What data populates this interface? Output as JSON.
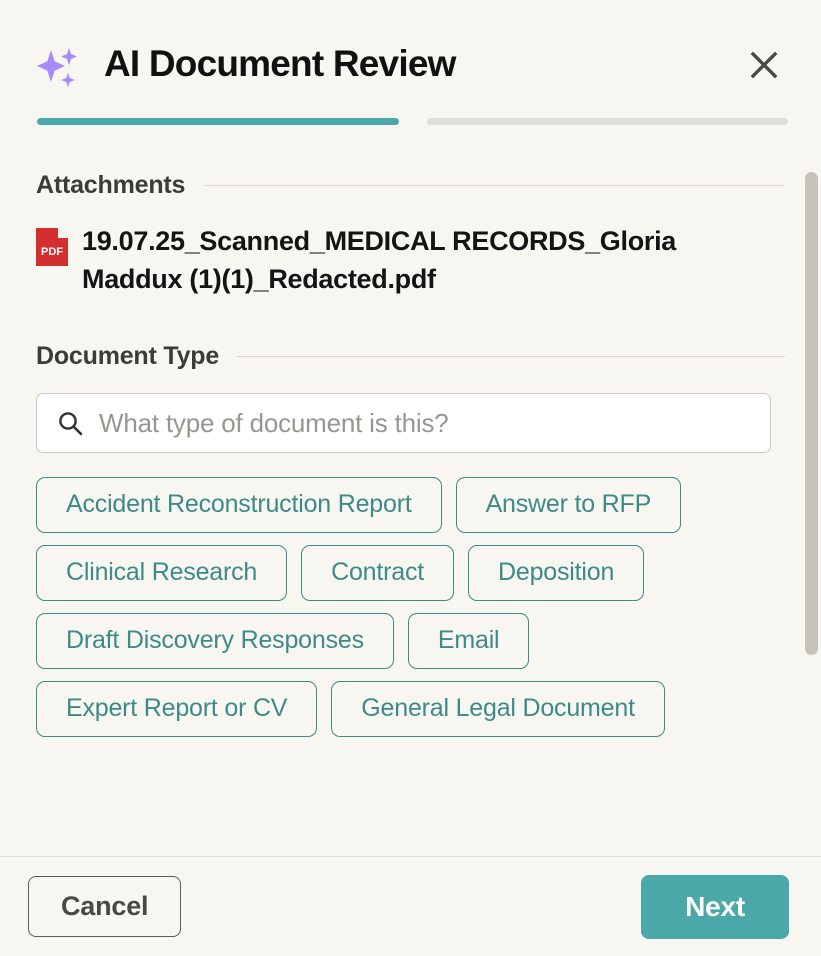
{
  "header": {
    "title": "AI Document Review",
    "sparkle_icon": "sparkle-icon",
    "close_icon": "close-icon",
    "accent_color": "#4ba8a8",
    "sparkle_color": "#a78bfa"
  },
  "progress": {
    "segments": [
      {
        "state": "active",
        "color": "#4ba8a8"
      },
      {
        "state": "inactive",
        "color": "#e0ded8"
      }
    ],
    "current_step": 1,
    "total_steps": 2
  },
  "attachments": {
    "section_title": "Attachments",
    "files": [
      {
        "name": "19.07.25_Scanned_MEDICAL RECORDS_Gloria Maddux (1)(1)_Redacted.pdf",
        "icon": "pdf-file-icon",
        "icon_label": "PDF",
        "icon_color": "#d32f2f"
      }
    ]
  },
  "document_type": {
    "section_title": "Document Type",
    "search": {
      "icon": "search-icon",
      "placeholder": "What type of document is this?",
      "value": ""
    },
    "options": [
      "Accident Reconstruction Report",
      "Answer to RFP",
      "Clinical Research",
      "Contract",
      "Deposition",
      "Draft Discovery Responses",
      "Email",
      "Expert Report or CV",
      "General Legal Document"
    ],
    "chip_color": "#3e8a86"
  },
  "footer": {
    "cancel_label": "Cancel",
    "next_label": "Next",
    "next_color": "#4ba8a8"
  }
}
